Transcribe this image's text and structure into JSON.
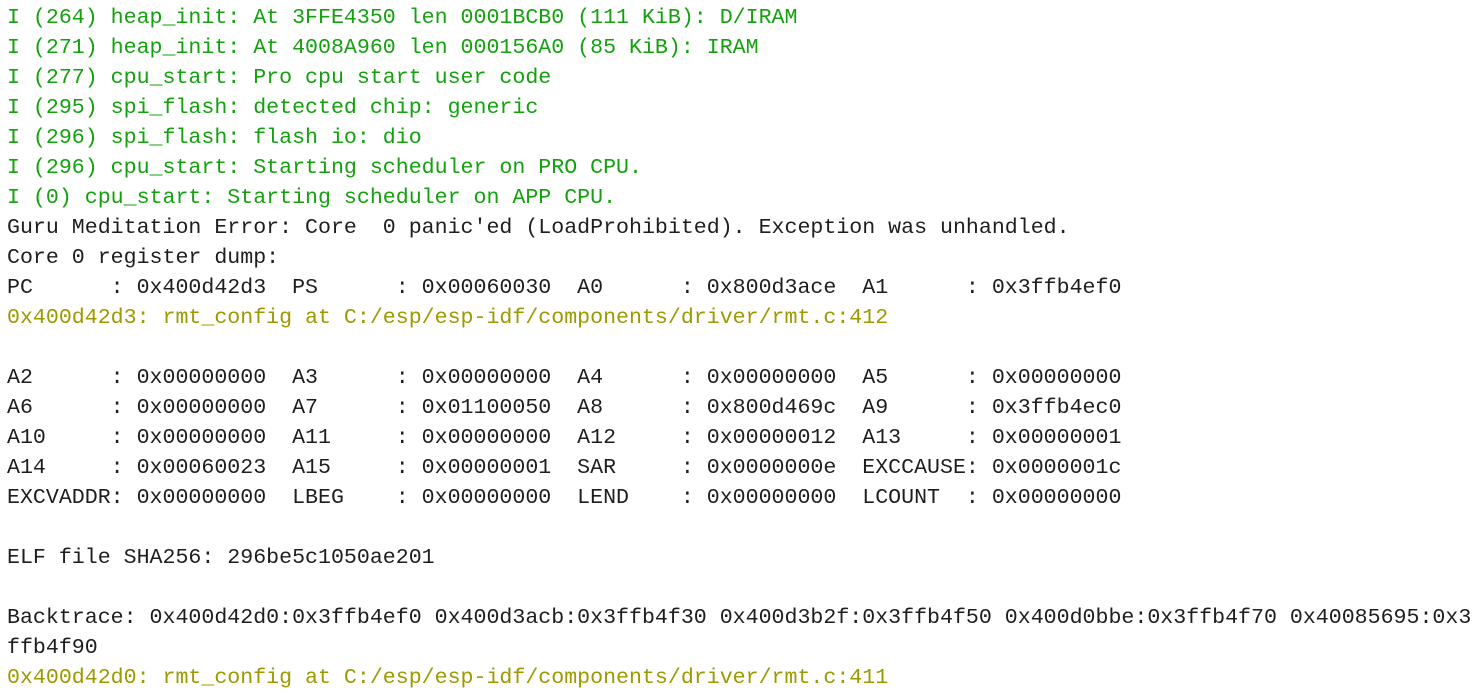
{
  "colors": {
    "info": "#13a10e",
    "addr": "#9c9a00",
    "plain": "#1e1e1e",
    "background": "#ffffff"
  },
  "lines": [
    {
      "type": "info",
      "text": "I (264) heap_init: At 3FFE4350 len 0001BCB0 (111 KiB): D/IRAM"
    },
    {
      "type": "info",
      "text": "I (271) heap_init: At 4008A960 len 000156A0 (85 KiB): IRAM"
    },
    {
      "type": "info",
      "text": "I (277) cpu_start: Pro cpu start user code"
    },
    {
      "type": "info",
      "text": "I (295) spi_flash: detected chip: generic"
    },
    {
      "type": "info",
      "text": "I (296) spi_flash: flash io: dio"
    },
    {
      "type": "info",
      "text": "I (296) cpu_start: Starting scheduler on PRO CPU."
    },
    {
      "type": "info",
      "text": "I (0) cpu_start: Starting scheduler on APP CPU."
    },
    {
      "type": "plain",
      "text": "Guru Meditation Error: Core  0 panic'ed (LoadProhibited). Exception was unhandled."
    },
    {
      "type": "plain",
      "text": "Core 0 register dump:"
    },
    {
      "type": "plain",
      "text": "PC      : 0x400d42d3  PS      : 0x00060030  A0      : 0x800d3ace  A1      : 0x3ffb4ef0"
    },
    {
      "type": "addr",
      "text": "0x400d42d3: rmt_config at C:/esp/esp-idf/components/driver/rmt.c:412"
    },
    {
      "type": "plain",
      "text": ""
    },
    {
      "type": "plain",
      "text": "A2      : 0x00000000  A3      : 0x00000000  A4      : 0x00000000  A5      : 0x00000000"
    },
    {
      "type": "plain",
      "text": "A6      : 0x00000000  A7      : 0x01100050  A8      : 0x800d469c  A9      : 0x3ffb4ec0"
    },
    {
      "type": "plain",
      "text": "A10     : 0x00000000  A11     : 0x00000000  A12     : 0x00000012  A13     : 0x00000001"
    },
    {
      "type": "plain",
      "text": "A14     : 0x00060023  A15     : 0x00000001  SAR     : 0x0000000e  EXCCAUSE: 0x0000001c"
    },
    {
      "type": "plain",
      "text": "EXCVADDR: 0x00000000  LBEG    : 0x00000000  LEND    : 0x00000000  LCOUNT  : 0x00000000"
    },
    {
      "type": "plain",
      "text": ""
    },
    {
      "type": "plain",
      "text": "ELF file SHA256: 296be5c1050ae201"
    },
    {
      "type": "plain",
      "text": ""
    },
    {
      "type": "plain",
      "text": "Backtrace: 0x400d42d0:0x3ffb4ef0 0x400d3acb:0x3ffb4f30 0x400d3b2f:0x3ffb4f50 0x400d0bbe:0x3ffb4f70 0x40085695:0x3ffb4f90"
    },
    {
      "type": "addr",
      "text": "0x400d42d0: rmt_config at C:/esp/esp-idf/components/driver/rmt.c:411"
    }
  ]
}
